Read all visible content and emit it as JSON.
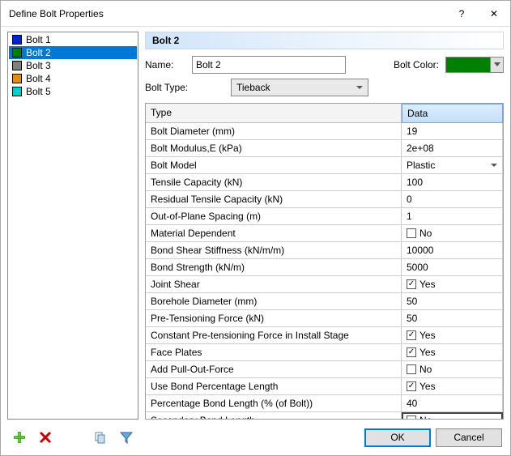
{
  "window": {
    "title": "Define Bolt Properties"
  },
  "bolts": [
    {
      "label": "Bolt 1",
      "color": "#0022dd",
      "selected": false
    },
    {
      "label": "Bolt 2",
      "color": "#008000",
      "selected": true
    },
    {
      "label": "Bolt 3",
      "color": "#808080",
      "selected": false
    },
    {
      "label": "Bolt 4",
      "color": "#e09000",
      "selected": false
    },
    {
      "label": "Bolt 5",
      "color": "#00d0d0",
      "selected": false
    }
  ],
  "header": {
    "title": "Bolt 2"
  },
  "form": {
    "name_label": "Name:",
    "name_value": "Bolt 2",
    "color_label": "Bolt Color:",
    "color_value": "#008000",
    "type_label": "Bolt Type:",
    "type_value": "Tieback"
  },
  "grid": {
    "col_type": "Type",
    "col_data": "Data",
    "rows": [
      {
        "label": "Bolt Diameter (mm)",
        "kind": "text",
        "value": "19"
      },
      {
        "label": "Bolt Modulus,E (kPa)",
        "kind": "text",
        "value": "2e+08"
      },
      {
        "label": "Bolt Model",
        "kind": "dropdown",
        "value": "Plastic"
      },
      {
        "label": "Tensile Capacity (kN)",
        "kind": "text",
        "value": "100"
      },
      {
        "label": "Residual Tensile Capacity (kN)",
        "kind": "text",
        "value": "0"
      },
      {
        "label": "Out-of-Plane Spacing (m)",
        "kind": "text",
        "value": "1"
      },
      {
        "label": "Material Dependent",
        "kind": "check",
        "checked": false,
        "value": "No"
      },
      {
        "label": "Bond Shear Stiffness (kN/m/m)",
        "kind": "text",
        "value": "10000"
      },
      {
        "label": "Bond Strength (kN/m)",
        "kind": "text",
        "value": "5000"
      },
      {
        "label": "Joint Shear",
        "kind": "check",
        "checked": true,
        "value": "Yes"
      },
      {
        "label": "Borehole Diameter (mm)",
        "kind": "text",
        "value": "50"
      },
      {
        "label": "Pre-Tensioning Force (kN)",
        "kind": "text",
        "value": "50"
      },
      {
        "label": "Constant Pre-tensioning Force in Install Stage",
        "kind": "check",
        "checked": true,
        "value": "Yes"
      },
      {
        "label": "Face Plates",
        "kind": "check",
        "checked": true,
        "value": "Yes"
      },
      {
        "label": "Add Pull-Out-Force",
        "kind": "check",
        "checked": false,
        "value": "No"
      },
      {
        "label": "Use Bond Percentage Length",
        "kind": "check",
        "checked": true,
        "value": "Yes"
      },
      {
        "label": "Percentage Bond Length (% (of Bolt))",
        "kind": "text",
        "value": "40"
      },
      {
        "label": "Secondary Bond Length",
        "kind": "check",
        "checked": false,
        "value": "No",
        "highlight": true
      }
    ]
  },
  "buttons": {
    "ok": "OK",
    "cancel": "Cancel"
  },
  "icons": {
    "add": "add-icon",
    "delete": "delete-icon",
    "copy": "copy-icon",
    "filter": "filter-icon"
  }
}
